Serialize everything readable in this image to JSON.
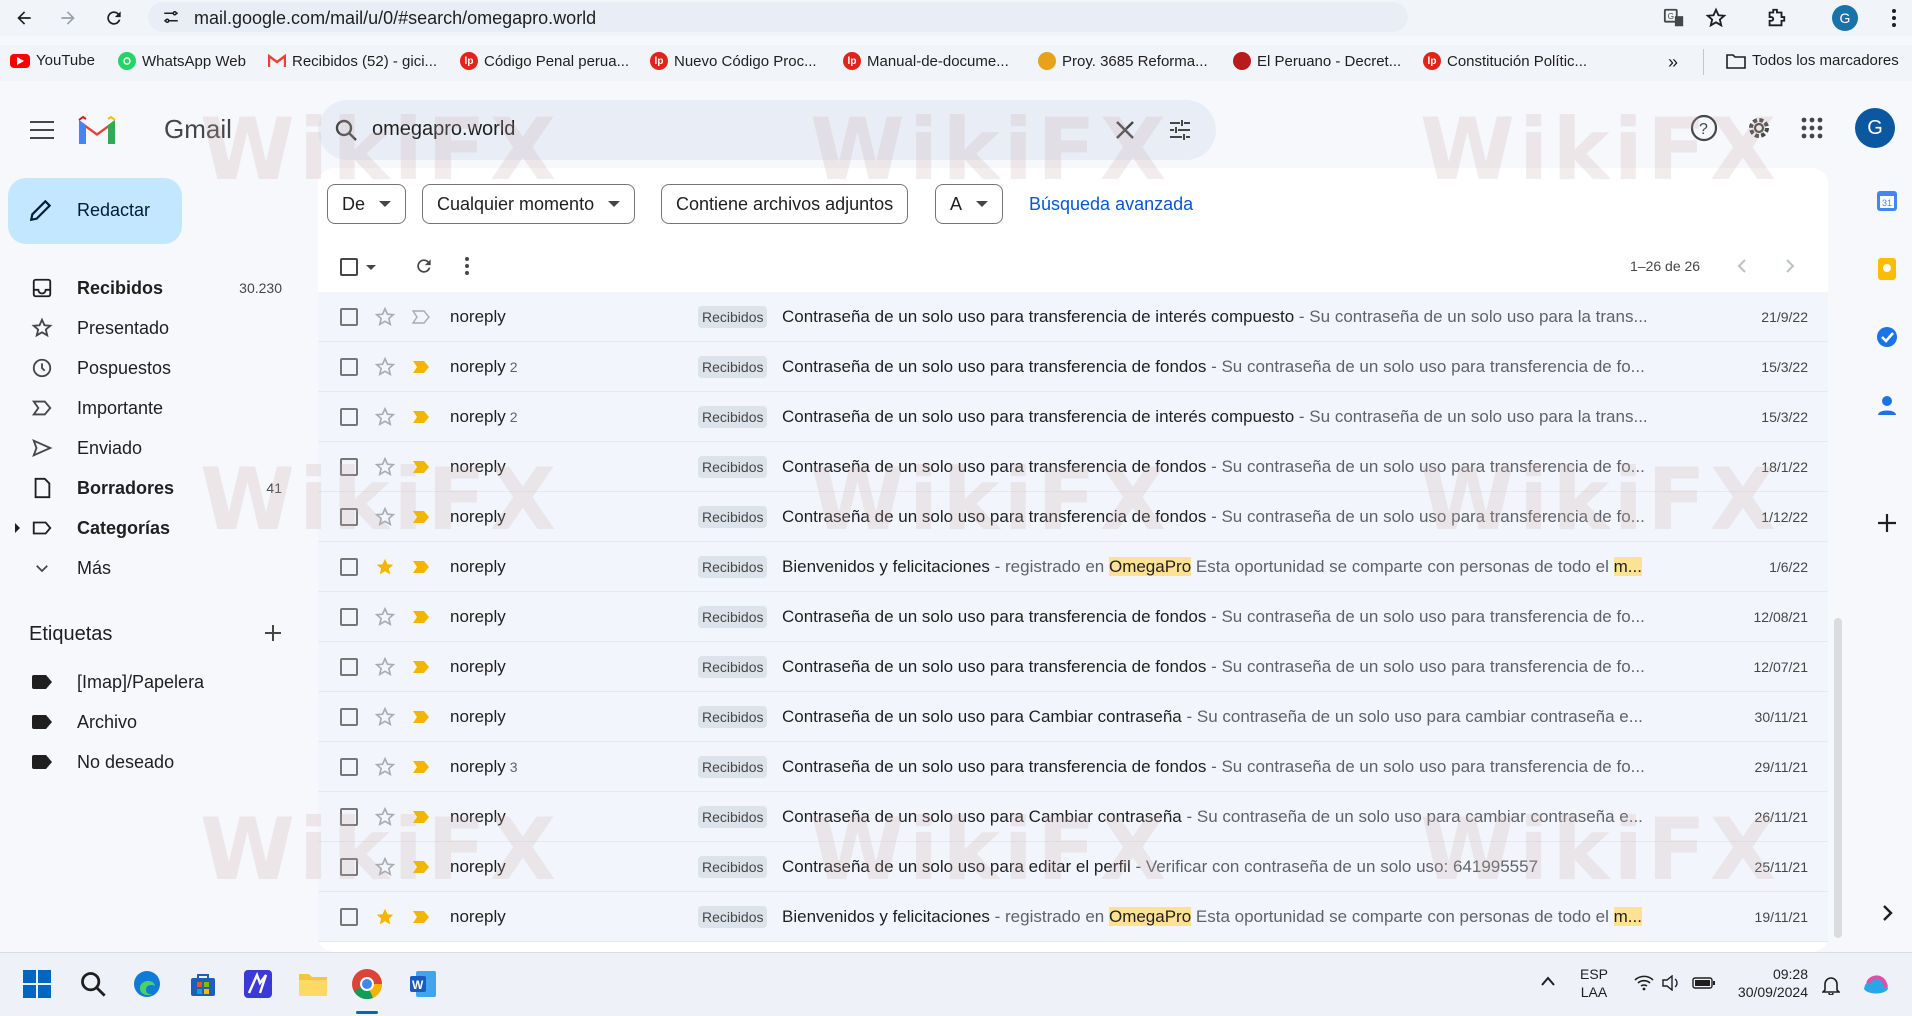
{
  "browser": {
    "url": "mail.google.com/mail/u/0/#search/omegapro.world",
    "profile_initial": "G",
    "bookmarks": [
      {
        "label": "YouTube",
        "icon": "youtube-icon",
        "color": "#ff0000"
      },
      {
        "label": "WhatsApp Web",
        "icon": "whatsapp-icon",
        "color": "#25d366"
      },
      {
        "label": "Recibidos (52) - gici...",
        "icon": "gmail-icon",
        "color": "#ea4335"
      },
      {
        "label": "Código Penal perua...",
        "icon": "lp-icon",
        "color": "#e0241b"
      },
      {
        "label": "Nuevo Código Proc...",
        "icon": "lp-icon",
        "color": "#e0241b"
      },
      {
        "label": "Manual-de-docume...",
        "icon": "lp-icon",
        "color": "#e0241b"
      },
      {
        "label": "Proy. 3685 Reforma...",
        "icon": "congress-icon",
        "color": "#e7a21a"
      },
      {
        "label": "El Peruano - Decret...",
        "icon": "peru-shield-icon",
        "color": "#b71c1c"
      },
      {
        "label": "Constitución Polític...",
        "icon": "lp-icon",
        "color": "#e0241b"
      }
    ],
    "all_bookmarks": "Todos los marcadores",
    "more": "»"
  },
  "gmail": {
    "logo": "Gmail",
    "search_value": "omegapro.world",
    "compose": "Redactar",
    "nav": [
      {
        "label": "Recibidos",
        "count": "30.230",
        "bold": true,
        "icon": "inbox-icon"
      },
      {
        "label": "Presentado",
        "count": "",
        "bold": false,
        "icon": "star-icon"
      },
      {
        "label": "Pospuestos",
        "count": "",
        "bold": false,
        "icon": "clock-icon"
      },
      {
        "label": "Importante",
        "count": "",
        "bold": false,
        "icon": "important-icon"
      },
      {
        "label": "Enviado",
        "count": "",
        "bold": false,
        "icon": "send-icon"
      },
      {
        "label": "Borradores",
        "count": "41",
        "bold": true,
        "icon": "draft-icon"
      },
      {
        "label": "Categorías",
        "count": "",
        "bold": true,
        "icon": "label-icon"
      },
      {
        "label": "Más",
        "count": "",
        "bold": false,
        "icon": "chevron-down-icon"
      }
    ],
    "labels_title": "Etiquetas",
    "labels": [
      "[Imap]/Papelera",
      "Archivo",
      "No deseado"
    ],
    "filters": {
      "from": "De",
      "time": "Cualquier momento",
      "attach": "Contiene archivos adjuntos",
      "to": "A",
      "advanced": "Búsqueda avanzada"
    },
    "range": "1–26 de 26",
    "emails": [
      {
        "sender": "noreply",
        "count": "",
        "starred": false,
        "important": false,
        "badge": "Recibidos",
        "subject": "Contraseña de un solo uso para transferencia de interés compuesto",
        "pre": " - Su contraseña de un solo uso para la trans...",
        "hl1": "",
        "mid": "",
        "hl2": "",
        "date": "21/9/22"
      },
      {
        "sender": "noreply",
        "count": "2",
        "starred": false,
        "important": true,
        "badge": "Recibidos",
        "subject": "Contraseña de un solo uso para transferencia de fondos",
        "pre": " - Su contraseña de un solo uso para transferencia de fo...",
        "hl1": "",
        "mid": "",
        "hl2": "",
        "date": "15/3/22"
      },
      {
        "sender": "noreply",
        "count": "2",
        "starred": false,
        "important": true,
        "badge": "Recibidos",
        "subject": "Contraseña de un solo uso para transferencia de interés compuesto",
        "pre": " - Su contraseña de un solo uso para la trans...",
        "hl1": "",
        "mid": "",
        "hl2": "",
        "date": "15/3/22"
      },
      {
        "sender": "noreply",
        "count": "",
        "starred": false,
        "important": true,
        "badge": "Recibidos",
        "subject": "Contraseña de un solo uso para transferencia de fondos",
        "pre": " - Su contraseña de un solo uso para transferencia de fo...",
        "hl1": "",
        "mid": "",
        "hl2": "",
        "date": "18/1/22"
      },
      {
        "sender": "noreply",
        "count": "",
        "starred": false,
        "important": true,
        "badge": "Recibidos",
        "subject": "Contraseña de un solo uso para transferencia de fondos",
        "pre": " - Su contraseña de un solo uso para transferencia de fo...",
        "hl1": "",
        "mid": "",
        "hl2": "",
        "date": "1/12/22"
      },
      {
        "sender": "noreply",
        "count": "",
        "starred": true,
        "important": true,
        "badge": "Recibidos",
        "subject": "Bienvenidos y felicitaciones",
        "pre": " - registrado en ",
        "hl1": "OmegaPro",
        "mid": " Esta oportunidad se comparte con personas de todo el ",
        "hl2": "m...",
        "date": "1/6/22"
      },
      {
        "sender": "noreply",
        "count": "",
        "starred": false,
        "important": true,
        "badge": "Recibidos",
        "subject": "Contraseña de un solo uso para transferencia de fondos",
        "pre": " - Su contraseña de un solo uso para transferencia de fo...",
        "hl1": "",
        "mid": "",
        "hl2": "",
        "date": "12/08/21"
      },
      {
        "sender": "noreply",
        "count": "",
        "starred": false,
        "important": true,
        "badge": "Recibidos",
        "subject": "Contraseña de un solo uso para transferencia de fondos",
        "pre": " - Su contraseña de un solo uso para transferencia de fo...",
        "hl1": "",
        "mid": "",
        "hl2": "",
        "date": "12/07/21"
      },
      {
        "sender": "noreply",
        "count": "",
        "starred": false,
        "important": true,
        "badge": "Recibidos",
        "subject": "Contraseña de un solo uso para Cambiar contraseña",
        "pre": " - Su contraseña de un solo uso para cambiar contraseña e...",
        "hl1": "",
        "mid": "",
        "hl2": "",
        "date": "30/11/21"
      },
      {
        "sender": "noreply",
        "count": "3",
        "starred": false,
        "important": true,
        "badge": "Recibidos",
        "subject": "Contraseña de un solo uso para transferencia de fondos",
        "pre": " - Su contraseña de un solo uso para transferencia de fo...",
        "hl1": "",
        "mid": "",
        "hl2": "",
        "date": "29/11/21"
      },
      {
        "sender": "noreply",
        "count": "",
        "starred": false,
        "important": true,
        "badge": "Recibidos",
        "subject": "Contraseña de un solo uso para Cambiar contraseña",
        "pre": " - Su contraseña de un solo uso para cambiar contraseña e...",
        "hl1": "",
        "mid": "",
        "hl2": "",
        "date": "26/11/21"
      },
      {
        "sender": "noreply",
        "count": "",
        "starred": false,
        "important": true,
        "badge": "Recibidos",
        "subject": "Contraseña de un solo uso para editar el perfil",
        "pre": " - Verificar con contraseña de un solo uso: 641995557",
        "hl1": "",
        "mid": "",
        "hl2": "",
        "date": "25/11/21"
      },
      {
        "sender": "noreply",
        "count": "",
        "starred": true,
        "important": true,
        "badge": "Recibidos",
        "subject": "Bienvenidos y felicitaciones",
        "pre": " - registrado en ",
        "hl1": "OmegaPro",
        "mid": " Esta oportunidad se comparte con personas de todo el ",
        "hl2": "m...",
        "date": "19/11/21"
      }
    ]
  },
  "taskbar": {
    "lang1": "ESP",
    "lang2": "LAA",
    "time": "09:28",
    "date": "30/09/2024"
  },
  "watermark": "WikiFX",
  "colors": {
    "compose_bg": "#c2e7ff",
    "link": "#0b57d0",
    "highlight": "#fde293",
    "important": "#f2b600",
    "star": "#f4b400"
  }
}
